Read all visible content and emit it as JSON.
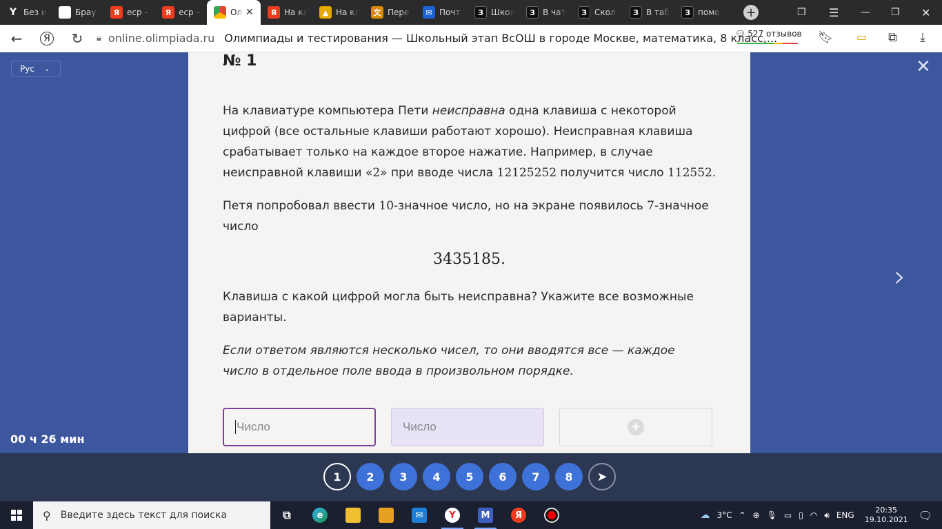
{
  "browser": {
    "tabs": [
      {
        "label": "Без и",
        "icon": "y-logo-icon"
      },
      {
        "label": "Брау",
        "icon": "yandex-browser-icon"
      },
      {
        "label": "еср –",
        "icon": "yandex-icon"
      },
      {
        "label": "еср –",
        "icon": "yandex-icon"
      },
      {
        "label": "Ол",
        "icon": "olympiad-icon",
        "active": true
      },
      {
        "label": "На кл",
        "icon": "yandex-icon"
      },
      {
        "label": "На кл",
        "icon": "image-icon"
      },
      {
        "label": "Пере",
        "icon": "translate-icon"
      },
      {
        "label": "Почт",
        "icon": "mail-icon"
      },
      {
        "label": "Школ",
        "icon": "znanija-icon"
      },
      {
        "label": "В чат",
        "icon": "znanija-icon"
      },
      {
        "label": "Скол",
        "icon": "znanija-icon"
      },
      {
        "label": "В таб",
        "icon": "znanija-icon"
      },
      {
        "label": "помо",
        "icon": "znanija-icon"
      }
    ],
    "domain": "online.olimpiada.ru",
    "page_title": "Олимпиады и тестирования — Школьный этап ВсОШ в городе Москве, математика, 8 класс,...",
    "reviews": "527 отзывов"
  },
  "page": {
    "language": "Рус",
    "timer": "00 ч 26 мин",
    "question_number": "№ 1",
    "paragraph1": {
      "a": "На клавиатуре компьютера Пети ",
      "b": "неисправна",
      "c": " одна клавиша с некоторой цифрой (все остальные клавиши работают хорошо). Неисправная клавиша срабатывает только на каждое второе нажатие. Например, в случае неисправной клавиши «",
      "d": "2",
      "e": "» при вводе числа ",
      "f": "12125252",
      "g": " получится число ",
      "h": "112552",
      "i": "."
    },
    "paragraph2": {
      "a": "Петя попробовал ввести ",
      "b": "10",
      "c": "-значное число, но на экране появилось ",
      "d": "7",
      "e": "-значное число"
    },
    "displayed_number": "3435185.",
    "question": "Клавиша с какой цифрой могла быть неисправна? Укажите все возможные варианты.",
    "note": "Если ответом являются несколько чисел, то они вводятся все — каждое число в отдельное поле ввода в произвольном порядке.",
    "answer_placeholder_1": "Число",
    "answer_placeholder_2": "Число",
    "add_field_symbol": "+"
  },
  "question_nav": {
    "items": [
      "1",
      "2",
      "3",
      "4",
      "5",
      "6",
      "7",
      "8"
    ],
    "current": "1",
    "send_icon": "send-arrow-icon"
  },
  "taskbar": {
    "search_placeholder": "Введите здесь текст для поиска",
    "temperature": "3°C",
    "language": "ENG",
    "time": "20:35",
    "date": "19.10.2021"
  },
  "colors": {
    "page_bg": "#3d579f",
    "card_bg": "#f5f4f2",
    "question_button": "#3f72d8",
    "nav_bar": "#2c3752",
    "input_focus_border": "#7a3fa0"
  }
}
